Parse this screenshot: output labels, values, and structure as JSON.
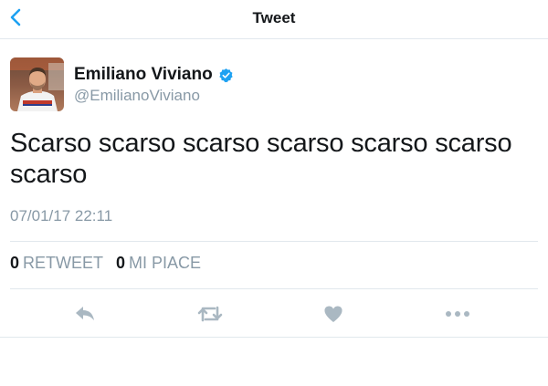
{
  "nav": {
    "title": "Tweet",
    "back_icon": "chevron-left-icon"
  },
  "author": {
    "display_name": "Emiliano Viviano",
    "handle": "@EmilianoViviano",
    "verified": true,
    "verified_icon": "verified-badge-icon"
  },
  "tweet": {
    "text": "Scarso scarso scarso scarso scarso scarso scarso",
    "timestamp": "07/01/17 22:11"
  },
  "stats": {
    "retweets_count": "0",
    "retweets_label": "RETWEET",
    "likes_count": "0",
    "likes_label": "MI PIACE"
  },
  "actions": [
    {
      "icon": "reply-icon"
    },
    {
      "icon": "retweet-icon"
    },
    {
      "icon": "heart-icon"
    },
    {
      "icon": "more-icon"
    }
  ],
  "colors": {
    "accent": "#1da1f2",
    "muted": "#8899a6",
    "text": "#14171a",
    "icon": "#aab8c2",
    "divider": "#e1e8ed"
  }
}
